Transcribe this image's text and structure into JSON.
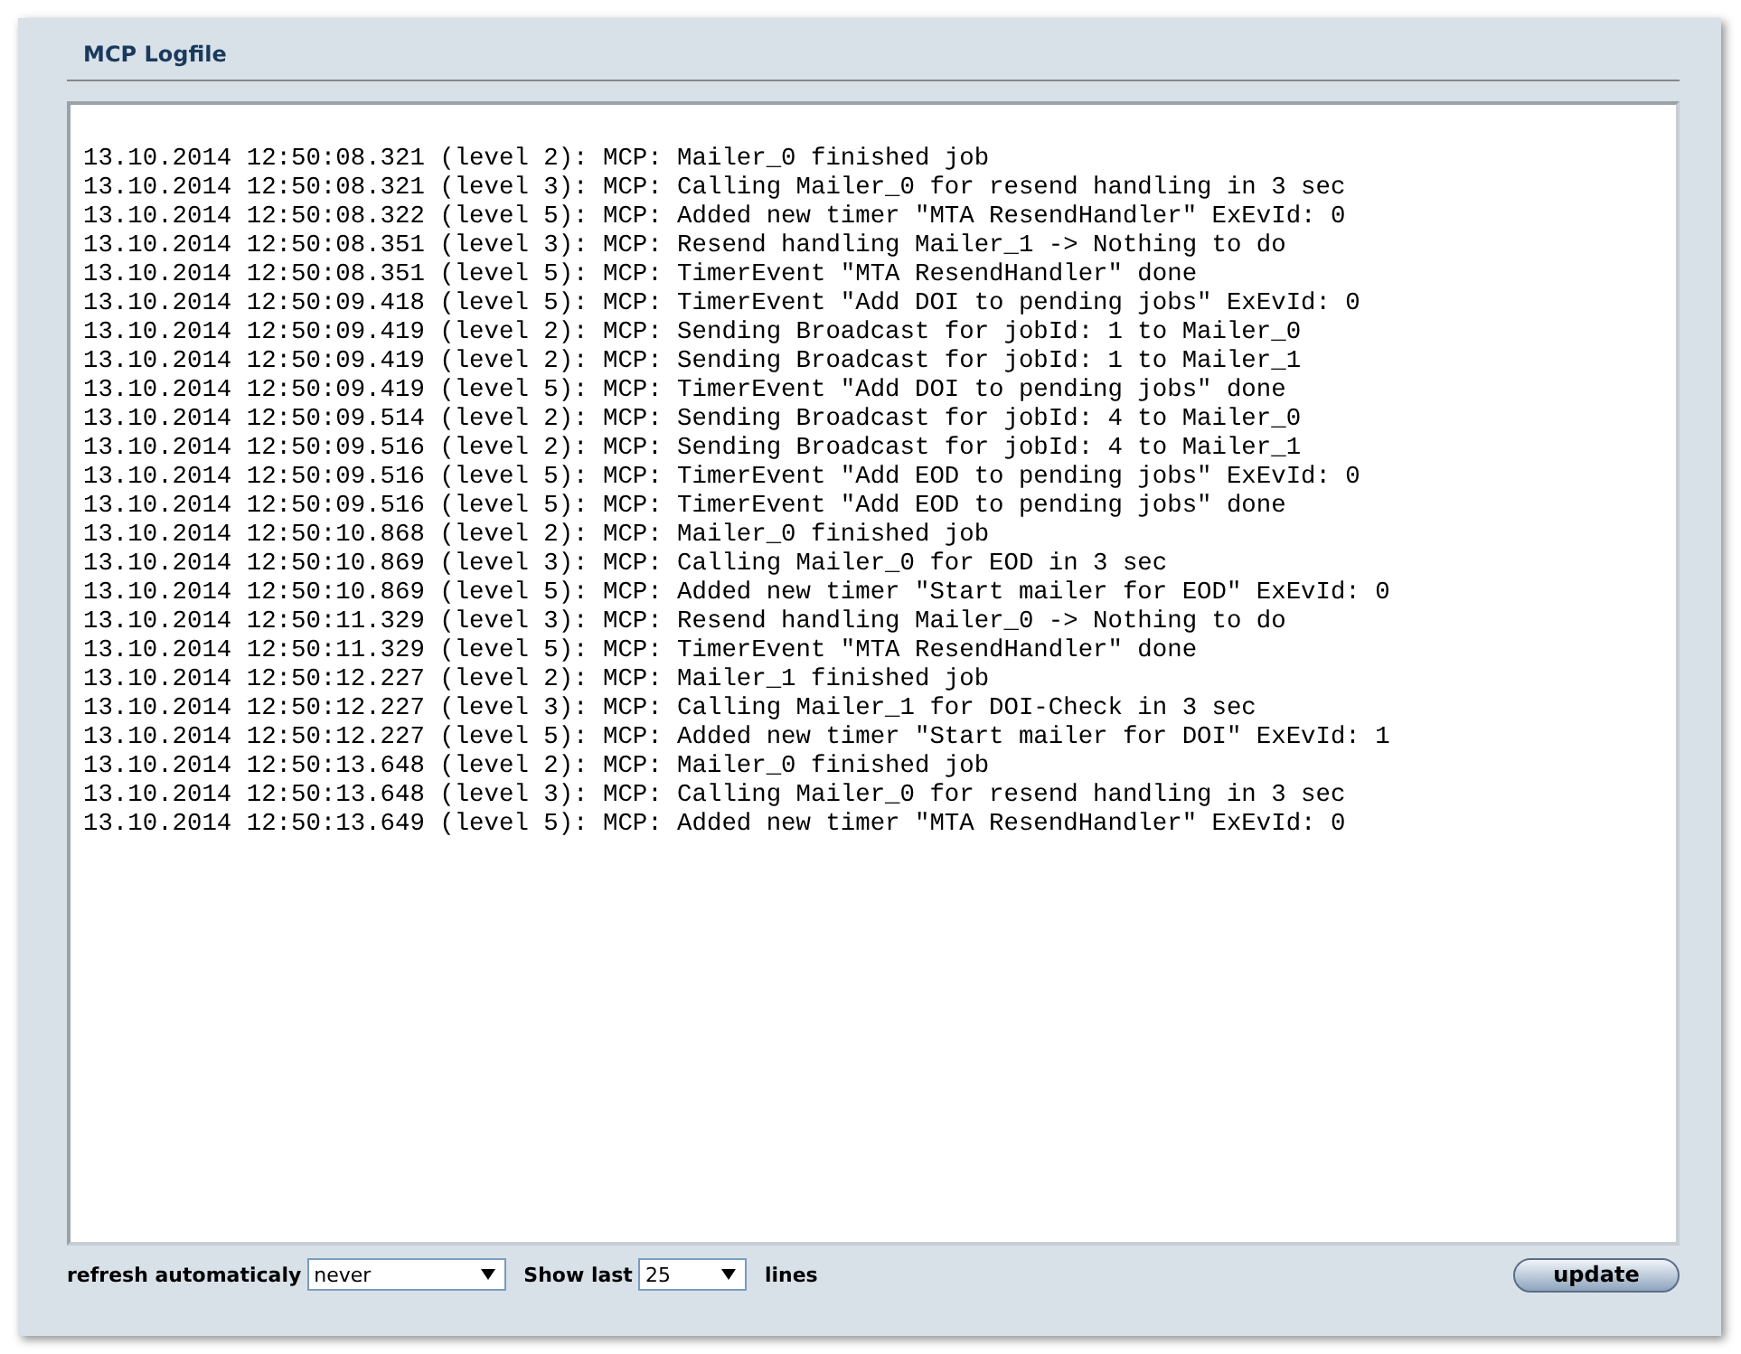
{
  "panel": {
    "title": "MCP Logfile"
  },
  "log_lines": [
    "13.10.2014 12:50:08.321 (level 2): MCP: Mailer_0 finished job",
    "13.10.2014 12:50:08.321 (level 3): MCP: Calling Mailer_0 for resend handling in 3 sec",
    "13.10.2014 12:50:08.322 (level 5): MCP: Added new timer \"MTA ResendHandler\" ExEvId: 0",
    "13.10.2014 12:50:08.351 (level 3): MCP: Resend handling Mailer_1 -> Nothing to do",
    "13.10.2014 12:50:08.351 (level 5): MCP: TimerEvent \"MTA ResendHandler\" done",
    "13.10.2014 12:50:09.418 (level 5): MCP: TimerEvent \"Add DOI to pending jobs\" ExEvId: 0",
    "13.10.2014 12:50:09.419 (level 2): MCP: Sending Broadcast for jobId: 1 to Mailer_0",
    "13.10.2014 12:50:09.419 (level 2): MCP: Sending Broadcast for jobId: 1 to Mailer_1",
    "13.10.2014 12:50:09.419 (level 5): MCP: TimerEvent \"Add DOI to pending jobs\" done",
    "13.10.2014 12:50:09.514 (level 2): MCP: Sending Broadcast for jobId: 4 to Mailer_0",
    "13.10.2014 12:50:09.516 (level 2): MCP: Sending Broadcast for jobId: 4 to Mailer_1",
    "13.10.2014 12:50:09.516 (level 5): MCP: TimerEvent \"Add EOD to pending jobs\" ExEvId: 0",
    "13.10.2014 12:50:09.516 (level 5): MCP: TimerEvent \"Add EOD to pending jobs\" done",
    "13.10.2014 12:50:10.868 (level 2): MCP: Mailer_0 finished job",
    "13.10.2014 12:50:10.869 (level 3): MCP: Calling Mailer_0 for EOD in 3 sec",
    "13.10.2014 12:50:10.869 (level 5): MCP: Added new timer \"Start mailer for EOD\" ExEvId: 0",
    "13.10.2014 12:50:11.329 (level 3): MCP: Resend handling Mailer_0 -> Nothing to do",
    "13.10.2014 12:50:11.329 (level 5): MCP: TimerEvent \"MTA ResendHandler\" done",
    "13.10.2014 12:50:12.227 (level 2): MCP: Mailer_1 finished job",
    "13.10.2014 12:50:12.227 (level 3): MCP: Calling Mailer_1 for DOI-Check in 3 sec",
    "13.10.2014 12:50:12.227 (level 5): MCP: Added new timer \"Start mailer for DOI\" ExEvId: 1",
    "13.10.2014 12:50:13.648 (level 2): MCP: Mailer_0 finished job",
    "13.10.2014 12:50:13.648 (level 3): MCP: Calling Mailer_0 for resend handling in 3 sec",
    "13.10.2014 12:50:13.649 (level 5): MCP: Added new timer \"MTA ResendHandler\" ExEvId: 0"
  ],
  "controls": {
    "refresh_label": "refresh automaticaly",
    "refresh_value": "never",
    "show_label": "Show last",
    "show_value": "25",
    "lines_label": "lines",
    "update_button": "update"
  }
}
